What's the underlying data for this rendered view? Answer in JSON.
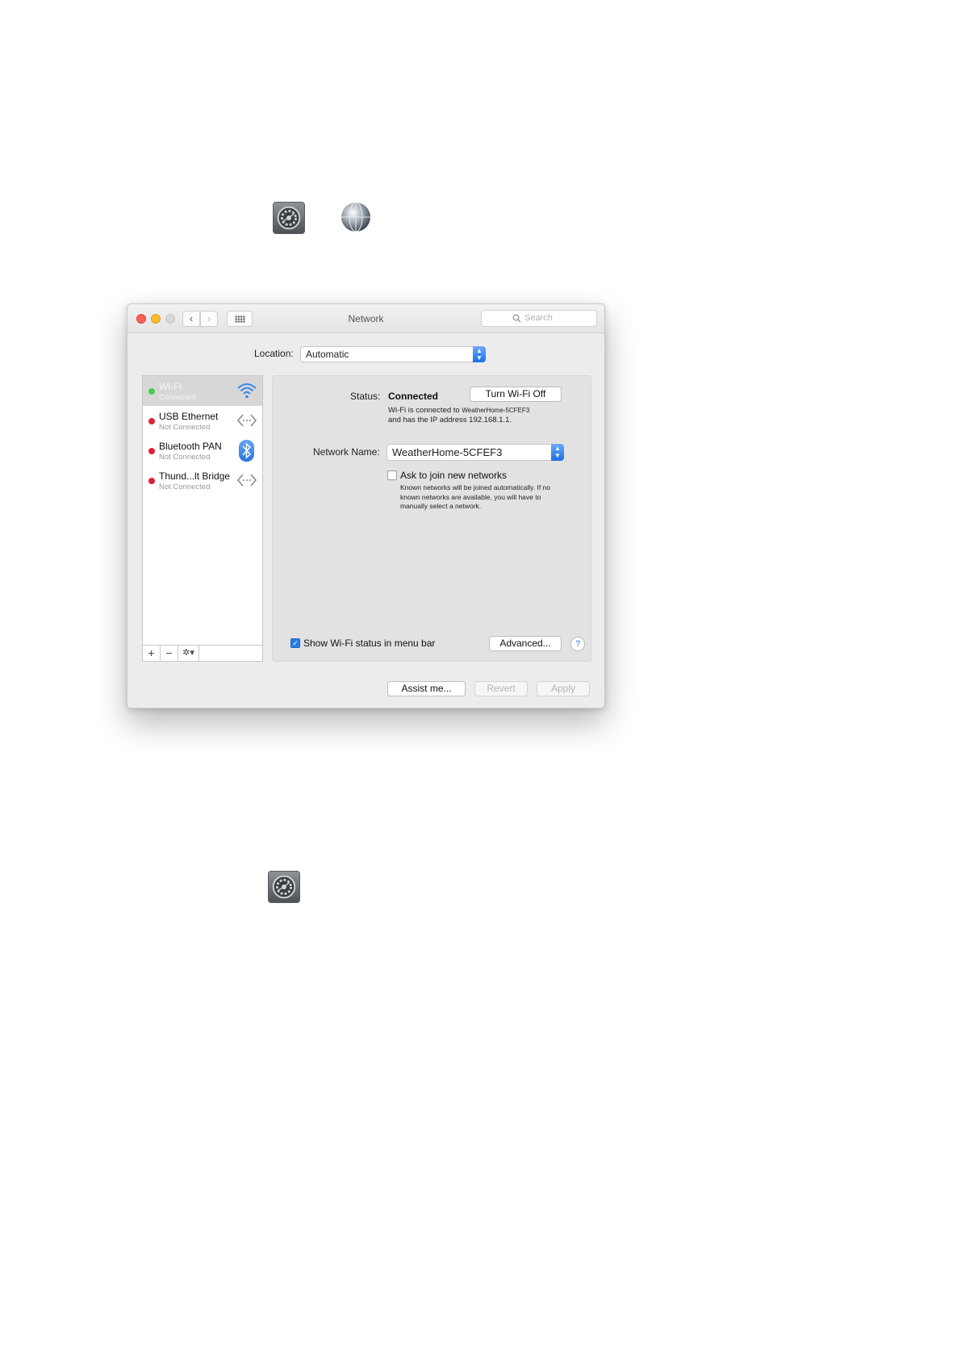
{
  "window": {
    "title": "Network",
    "search_placeholder": "Search",
    "nav_back_glyph": "‹",
    "nav_forward_glyph": "›"
  },
  "location": {
    "label": "Location:",
    "value": "Automatic"
  },
  "services": [
    {
      "name": "Wi-Fi",
      "status": "Connected",
      "status_color": "#4cc94c",
      "icon": "wifi-icon",
      "selected": true
    },
    {
      "name": "USB Ethernet",
      "status": "Not Connected",
      "status_color": "#e0213a",
      "icon": "ethernet-arrows-icon",
      "selected": false
    },
    {
      "name": "Bluetooth PAN",
      "status": "Not Connected",
      "status_color": "#e0213a",
      "icon": "bluetooth-icon",
      "selected": false
    },
    {
      "name": "Thund...lt Bridge",
      "status": "Not Connected",
      "status_color": "#e0213a",
      "icon": "ethernet-arrows-icon",
      "selected": false
    }
  ],
  "sidebar_toolbar": {
    "add": "+",
    "remove": "−",
    "action": "✲▾"
  },
  "detail": {
    "status_label": "Status:",
    "status_value": "Connected",
    "turn_off_label": "Turn Wi-Fi Off",
    "status_desc_prefix": "Wi-Fi is connected to",
    "status_desc_network": "WeatherHome-5CFEF3",
    "status_desc_suffix": "and has the IP address 192.168.1.1.",
    "network_name_label": "Network Name:",
    "network_name_value": "WeatherHome-5CFEF3",
    "ask_label": "Ask to join new networks",
    "ask_checked": false,
    "ask_desc": "Known networks will be joined automatically. If no known networks are available, you will have to manually select a network.",
    "show_status_label": "Show Wi-Fi status in menu bar",
    "show_status_checked": true,
    "advanced_label": "Advanced...",
    "help_label": "?"
  },
  "footer": {
    "assist_label": "Assist me...",
    "revert_label": "Revert",
    "apply_label": "Apply"
  },
  "page_icons": [
    "system-preferences-icon",
    "network-globe-icon",
    "system-preferences-icon"
  ],
  "colors": {
    "accent": "#2b7de9",
    "connected": "#4cc94c",
    "disconnected": "#e0213a"
  }
}
